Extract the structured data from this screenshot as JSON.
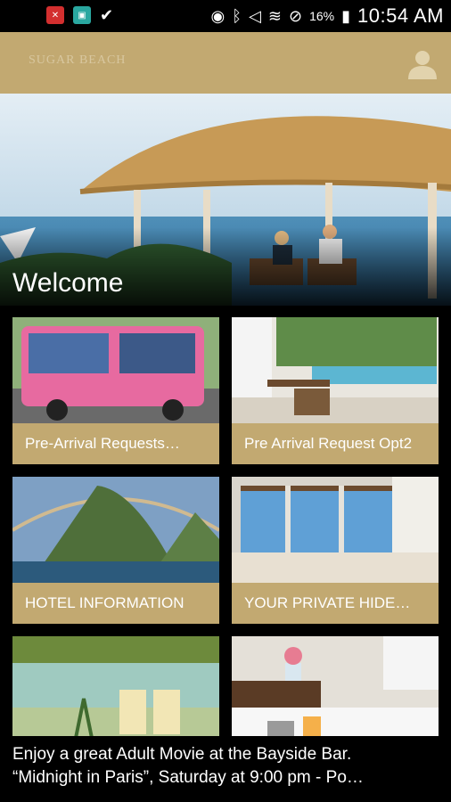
{
  "status_bar": {
    "time": "10:54 AM",
    "battery": "16%",
    "icons": [
      "close-notification-icon",
      "app-notification-icon",
      "checkmark-icon",
      "eye-icon",
      "bluetooth-icon",
      "mute-icon",
      "wifi-icon",
      "do-not-disturb-icon",
      "battery-charging-icon"
    ]
  },
  "header": {
    "logo_text": "SUGAR BEACH",
    "brand_color": "#c2a971"
  },
  "hero": {
    "title": "Welcome"
  },
  "tiles": [
    {
      "label": "Pre-Arrival Requests…"
    },
    {
      "label": "Pre Arrival Request Opt2"
    },
    {
      "label": "HOTEL INFORMATION"
    },
    {
      "label": "YOUR PRIVATE HIDE…"
    },
    {
      "label": ""
    },
    {
      "label": ""
    }
  ],
  "ticker": {
    "line1": "Enjoy a great Adult Movie at the Bayside Bar.",
    "line2": "“Midnight in Paris”, Saturday at 9:00 pm - Po…"
  }
}
